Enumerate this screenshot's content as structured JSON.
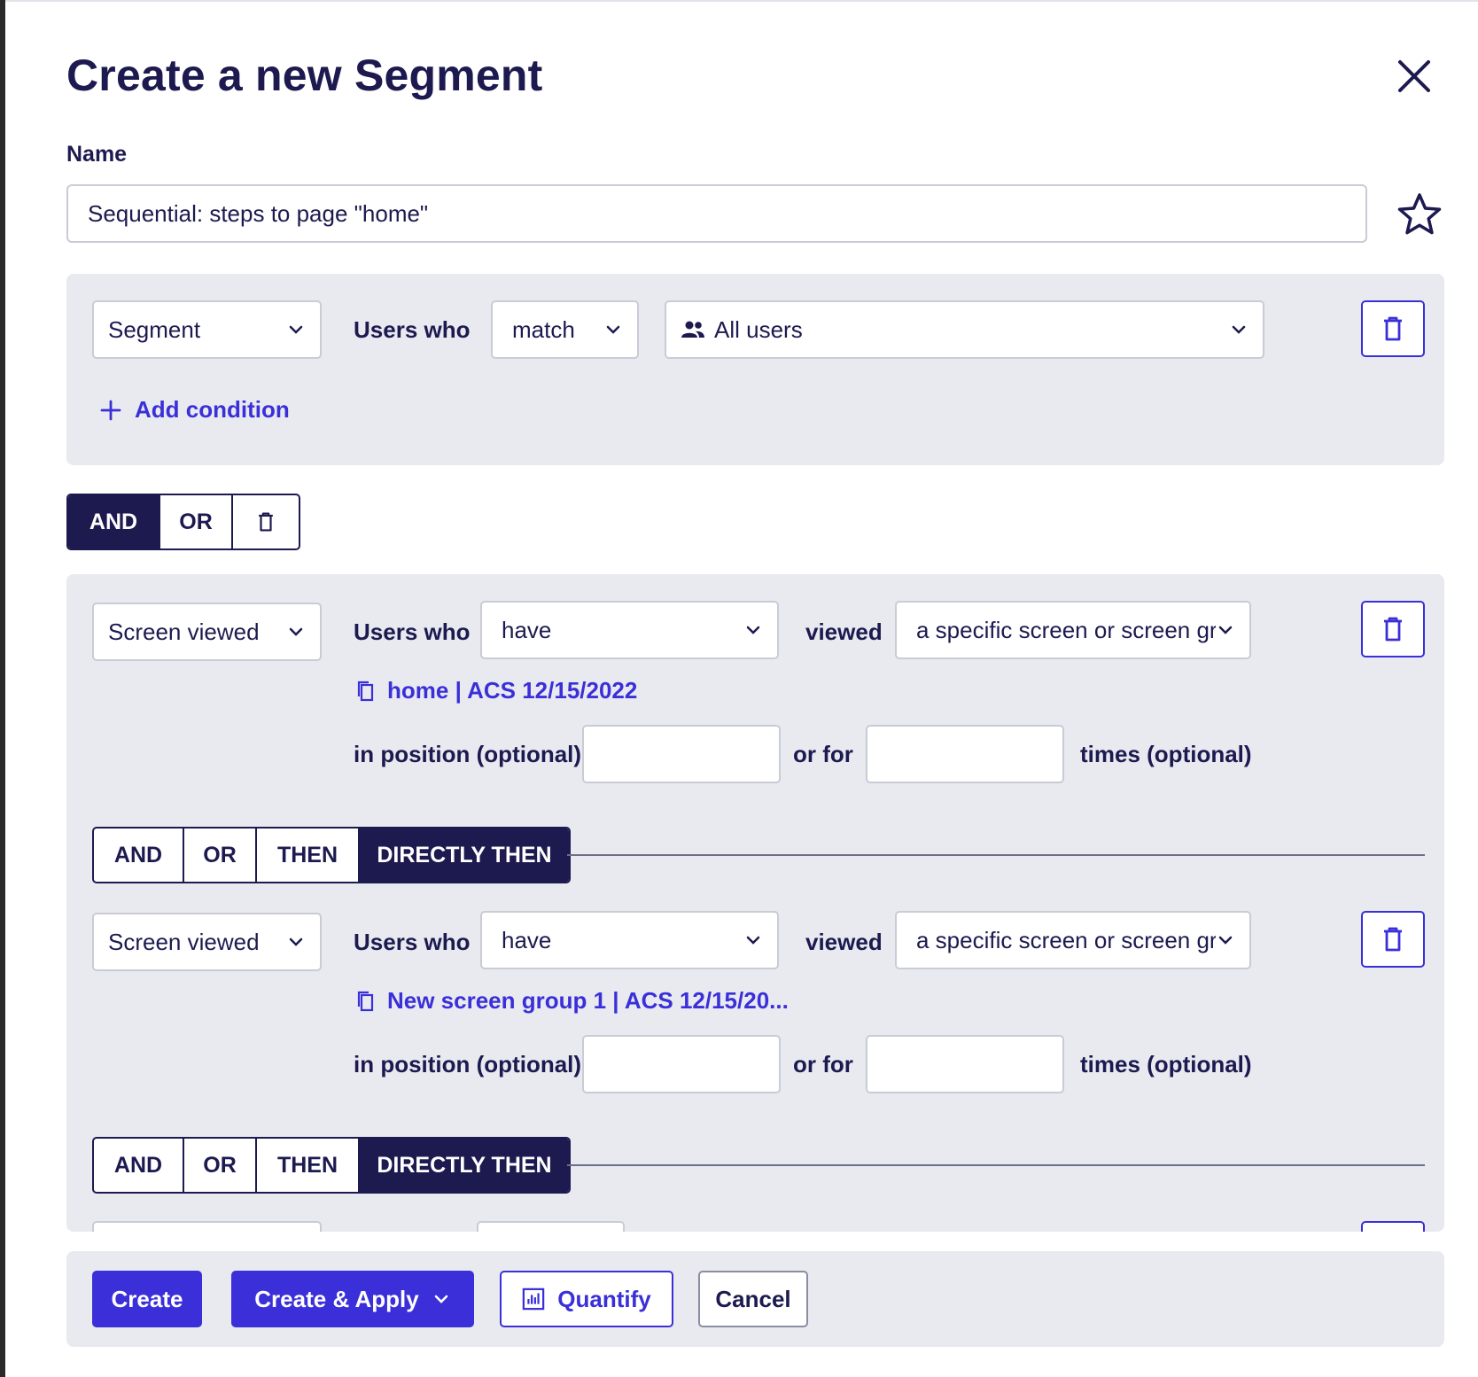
{
  "dialog": {
    "title": "Create a new Segment",
    "name_label": "Name",
    "name_value": "Sequential: steps to page \"home\""
  },
  "segment_block": {
    "type_select": "Segment",
    "users_who_label": "Users who",
    "match_select": "match",
    "audience_select": "All users",
    "add_condition": "Add condition"
  },
  "top_operator": {
    "and": "AND",
    "or": "OR",
    "active": "AND"
  },
  "conditions": [
    {
      "type_select": "Screen viewed",
      "users_who_label": "Users who",
      "have_select": "have",
      "viewed_label": "viewed",
      "target_select": "a specific screen or screen group",
      "screen_link": "home | ACS 12/15/2022",
      "position_label": "in position (optional)",
      "or_for_label": "or for",
      "times_label": "times (optional)"
    },
    {
      "type_select": "Screen viewed",
      "users_who_label": "Users who",
      "have_select": "have",
      "viewed_label": "viewed",
      "target_select": "a specific screen or screen group",
      "screen_link": "New screen group 1 | ACS 12/15/20...",
      "position_label": "in position (optional)",
      "or_for_label": "or for",
      "times_label": "times (optional)"
    }
  ],
  "sequence_operators": {
    "and": "AND",
    "or": "OR",
    "then": "THEN",
    "directly_then": "DIRECTLY THEN",
    "active": "DIRECTLY THEN"
  },
  "footer": {
    "create": "Create",
    "create_apply": "Create & Apply",
    "quantify": "Quantify",
    "cancel": "Cancel"
  },
  "colors": {
    "brand_navy": "#1c1a4f",
    "accent_blue": "#3a2fd8",
    "panel_bg": "#e8eaf0"
  }
}
